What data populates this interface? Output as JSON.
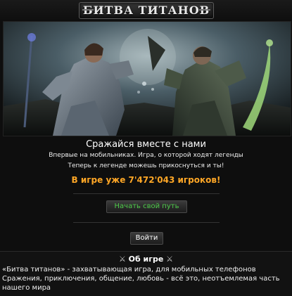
{
  "header": {
    "logo_text": "БИТВА ТИТАНОВ"
  },
  "hero": {
    "tagline": "Сражайся вместе с нами",
    "line1": "Впервые на мобильниках. Игра, о которой ходят легенды",
    "line2": "Теперь к легенде можешь прикоснуться и ты!",
    "players_text": "В игре уже 7'472'043 игроков!",
    "players_color": "#ffa726"
  },
  "buttons": {
    "start_label": "Начать свой путь",
    "start_color": "#4ec94a",
    "login_label": "Войти"
  },
  "about": {
    "title": "Об игре",
    "title_icon": "crossed-swords-icon",
    "text": "«Битва титанов» - захватывающая игра, для мобильных телефонов Сражения, приключения, общение, любовь - всё это, неотъемлемая часть нашего мира"
  }
}
